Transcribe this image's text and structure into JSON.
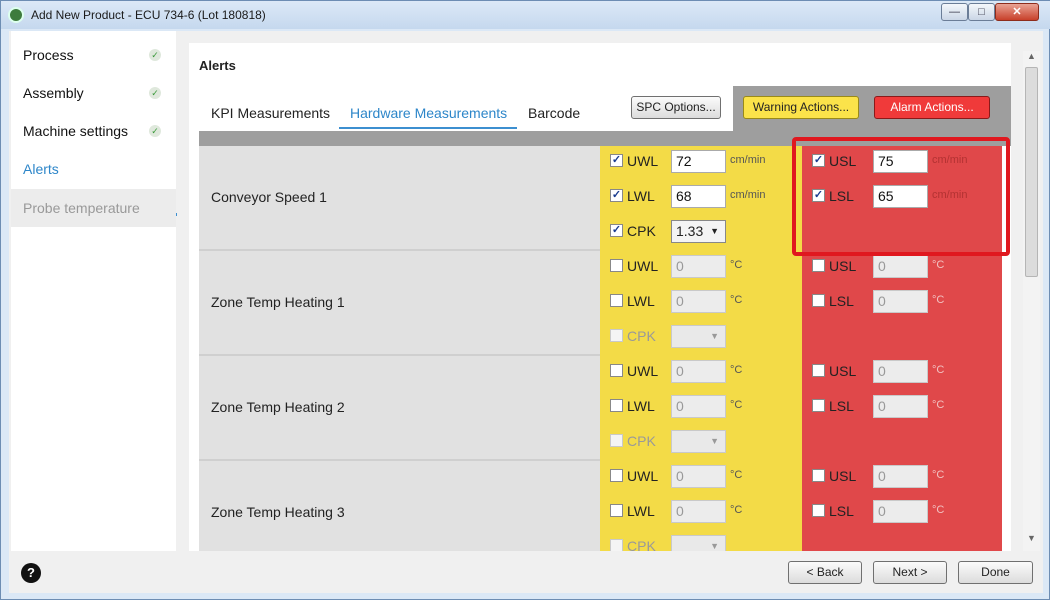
{
  "window": {
    "title": "Add New Product - ECU 734-6 (Lot 180818)",
    "min": "—",
    "max": "□",
    "close": "✕"
  },
  "sidebar": {
    "items": [
      {
        "label": "Process",
        "state": "done",
        "check": "✓"
      },
      {
        "label": "Assembly",
        "state": "done",
        "check": "✓"
      },
      {
        "label": "Machine settings",
        "state": "done",
        "check": "✓"
      },
      {
        "label": "Alerts",
        "state": "active"
      },
      {
        "label": "Probe temperature",
        "state": "disabled"
      }
    ]
  },
  "main": {
    "title": "Alerts",
    "tabs": [
      {
        "label": "KPI Measurements"
      },
      {
        "label": "Hardware Measurements",
        "active": true
      },
      {
        "label": "Barcode"
      }
    ],
    "buttons": {
      "spc": "SPC Options...",
      "warning": "Warning Actions...",
      "alarm": "Alarm Actions..."
    },
    "rows": [
      {
        "name": "Conveyor Speed 1",
        "uwl": {
          "label": "UWL",
          "checked": true,
          "value": "72",
          "unit": "cm/min"
        },
        "lwl": {
          "label": "LWL",
          "checked": true,
          "value": "68",
          "unit": "cm/min"
        },
        "cpk": {
          "label": "CPK",
          "checked": true,
          "value": "1.33"
        },
        "usl": {
          "label": "USL",
          "checked": true,
          "value": "75",
          "unit": "cm/min"
        },
        "lsl": {
          "label": "LSL",
          "checked": true,
          "value": "65",
          "unit": "cm/min"
        }
      },
      {
        "name": "Zone Temp Heating 1",
        "uwl": {
          "label": "UWL",
          "checked": false,
          "value": "0",
          "unit": "°C"
        },
        "lwl": {
          "label": "LWL",
          "checked": false,
          "value": "0",
          "unit": "°C"
        },
        "cpk": {
          "label": "CPK",
          "checked": false,
          "value": ""
        },
        "usl": {
          "label": "USL",
          "checked": false,
          "value": "0",
          "unit": "°C"
        },
        "lsl": {
          "label": "LSL",
          "checked": false,
          "value": "0",
          "unit": "°C"
        }
      },
      {
        "name": "Zone Temp Heating 2",
        "uwl": {
          "label": "UWL",
          "checked": false,
          "value": "0",
          "unit": "°C"
        },
        "lwl": {
          "label": "LWL",
          "checked": false,
          "value": "0",
          "unit": "°C"
        },
        "cpk": {
          "label": "CPK",
          "checked": false,
          "value": ""
        },
        "usl": {
          "label": "USL",
          "checked": false,
          "value": "0",
          "unit": "°C"
        },
        "lsl": {
          "label": "LSL",
          "checked": false,
          "value": "0",
          "unit": "°C"
        }
      },
      {
        "name": "Zone Temp Heating 3",
        "uwl": {
          "label": "UWL",
          "checked": false,
          "value": "0",
          "unit": "°C"
        },
        "lwl": {
          "label": "LWL",
          "checked": false,
          "value": "0",
          "unit": "°C"
        },
        "cpk": {
          "label": "CPK",
          "checked": false,
          "value": ""
        },
        "usl": {
          "label": "USL",
          "checked": false,
          "value": "0",
          "unit": "°C"
        },
        "lsl": {
          "label": "LSL",
          "checked": false,
          "value": "0",
          "unit": "°C"
        }
      }
    ]
  },
  "footer": {
    "help": "?",
    "back": "< Back",
    "next": "Next >",
    "done": "Done"
  },
  "colors": {
    "warning": "#f3db47",
    "alarm": "#e0484a",
    "accent": "#2d86c9",
    "highlight": "#e0181f"
  }
}
